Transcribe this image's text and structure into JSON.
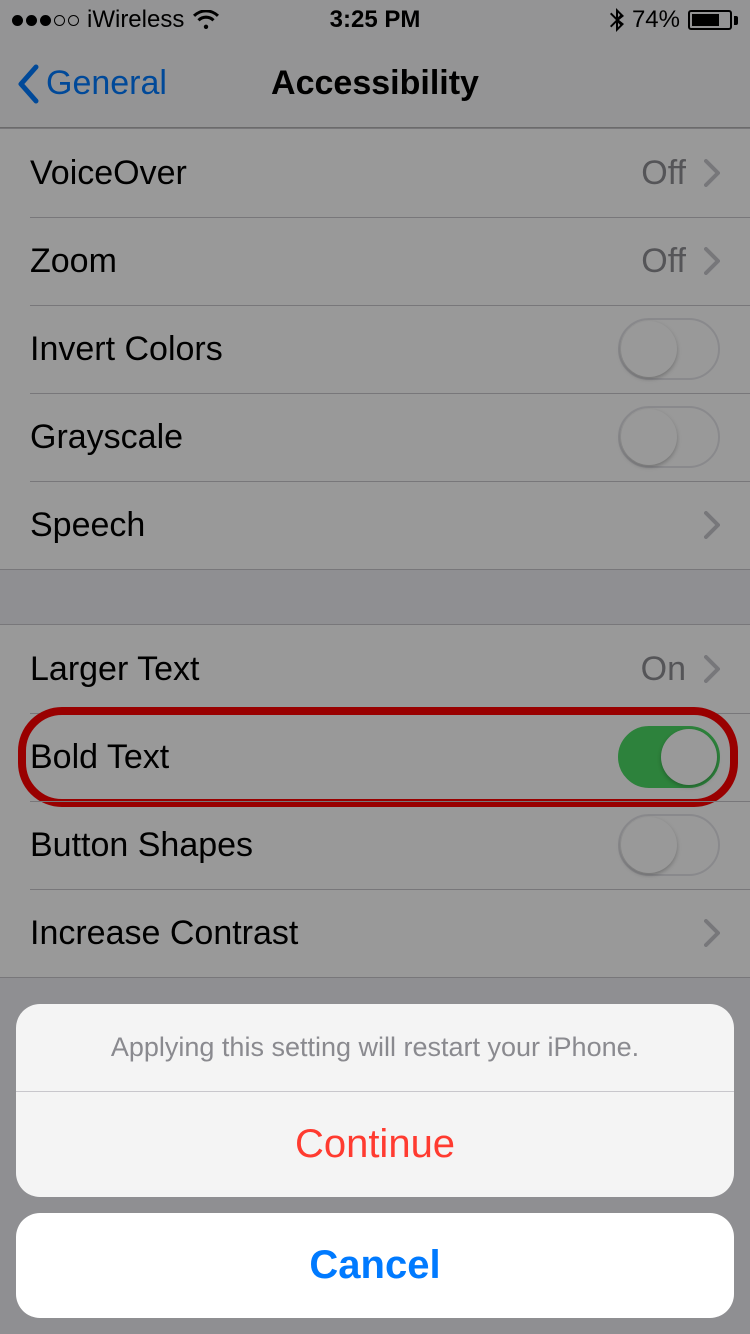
{
  "status": {
    "carrier": "iWireless",
    "time": "3:25 PM",
    "battery_percent": "74%",
    "battery_fill_pct": 74
  },
  "nav": {
    "back_label": "General",
    "title": "Accessibility"
  },
  "section1": {
    "voiceover": {
      "label": "VoiceOver",
      "value": "Off"
    },
    "zoom": {
      "label": "Zoom",
      "value": "Off"
    },
    "invert": {
      "label": "Invert Colors"
    },
    "grayscale": {
      "label": "Grayscale"
    },
    "speech": {
      "label": "Speech"
    }
  },
  "section2": {
    "larger": {
      "label": "Larger Text",
      "value": "On"
    },
    "bold": {
      "label": "Bold Text"
    },
    "shapes": {
      "label": "Button Shapes"
    },
    "contrast": {
      "label": "Increase Contrast"
    }
  },
  "alert": {
    "message": "Applying this setting will restart your iPhone.",
    "continue": "Continue",
    "cancel": "Cancel"
  }
}
